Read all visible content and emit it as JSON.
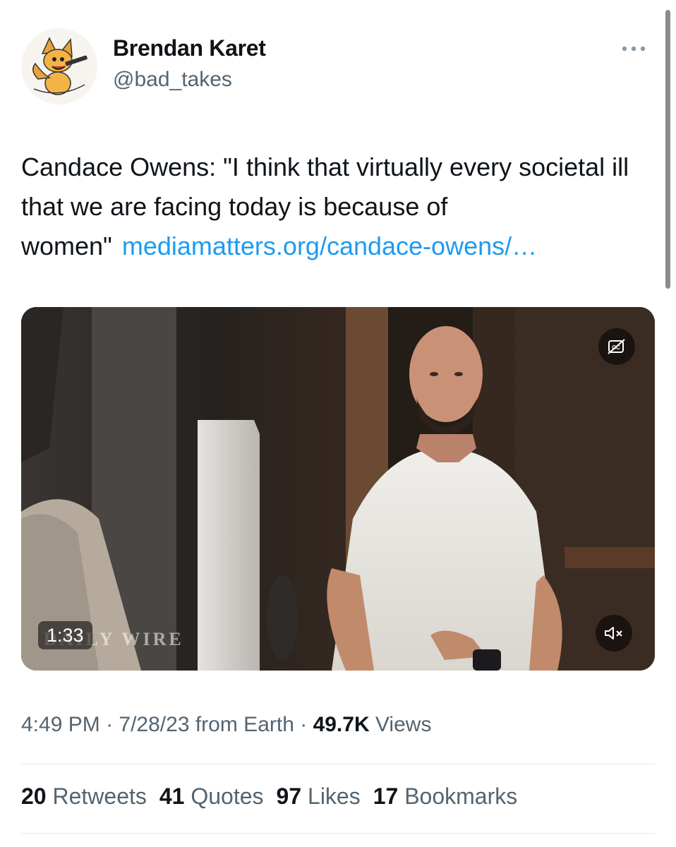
{
  "author": {
    "name": "Brendan Karet",
    "handle": "@bad_takes"
  },
  "tweet": {
    "text": "Candace Owens: \"I think that virtually every societal ill that we are facing today is because of women\"",
    "link": "mediamatters.org/candace-owens/…"
  },
  "video": {
    "duration": "1:33",
    "watermark": "DAILY WIRE"
  },
  "meta": {
    "time": "4:49 PM",
    "date": "7/28/23",
    "source": "from Earth",
    "views_count": "49.7K",
    "views_label": "Views"
  },
  "stats": [
    {
      "count": "20",
      "label": "Retweets"
    },
    {
      "count": "41",
      "label": "Quotes"
    },
    {
      "count": "97",
      "label": "Likes"
    },
    {
      "count": "17",
      "label": "Bookmarks"
    }
  ],
  "colors": {
    "link": "#1d9bf0",
    "secondary_text": "#536471",
    "primary_text": "#0f1419"
  }
}
